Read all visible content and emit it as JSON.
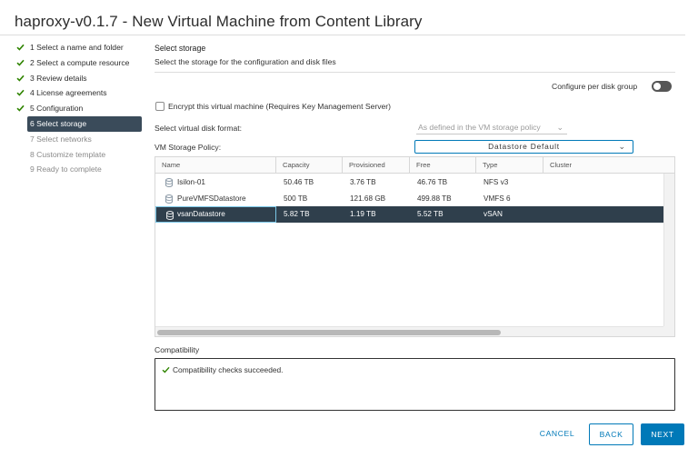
{
  "window": {
    "title": "haproxy-v0.1.7 - New Virtual Machine from Content Library"
  },
  "steps": [
    {
      "num": "1",
      "label": "1 Select a name and folder",
      "state": "done"
    },
    {
      "num": "2",
      "label": "2 Select a compute resource",
      "state": "done"
    },
    {
      "num": "3",
      "label": "3 Review details",
      "state": "done"
    },
    {
      "num": "4",
      "label": "4 License agreements",
      "state": "done"
    },
    {
      "num": "5",
      "label": "5 Configuration",
      "state": "done"
    },
    {
      "num": "6",
      "label": "6 Select storage",
      "state": "active"
    },
    {
      "num": "7",
      "label": "7 Select networks",
      "state": "pending"
    },
    {
      "num": "8",
      "label": "8 Customize template",
      "state": "pending"
    },
    {
      "num": "9",
      "label": "9 Ready to complete",
      "state": "pending"
    }
  ],
  "section": {
    "title": "Select storage",
    "subtitle": "Select the storage for the configuration and disk files"
  },
  "configure_per_disk": {
    "label": "Configure per disk group",
    "enabled": false
  },
  "encrypt": {
    "label": "Encrypt this virtual machine (Requires Key Management Server)",
    "checked": false
  },
  "disk_format": {
    "label": "Select virtual disk format:",
    "value": "As defined in the VM storage policy"
  },
  "storage_policy": {
    "label": "VM Storage Policy:",
    "value": "Datastore Default"
  },
  "grid": {
    "columns": [
      "Name",
      "Capacity",
      "Provisioned",
      "Free",
      "Type",
      "Cluster"
    ],
    "rows": [
      {
        "name": "Isilon-01",
        "capacity": "50.46 TB",
        "provisioned": "3.76 TB",
        "free": "46.76 TB",
        "type": "NFS v3",
        "cluster": "",
        "selected": false
      },
      {
        "name": "PureVMFSDatastore",
        "capacity": "500 TB",
        "provisioned": "121.68 GB",
        "free": "499.88 TB",
        "type": "VMFS 6",
        "cluster": "",
        "selected": false
      },
      {
        "name": "vsanDatastore",
        "capacity": "5.82 TB",
        "provisioned": "1.19 TB",
        "free": "5.52 TB",
        "type": "vSAN",
        "cluster": "",
        "selected": true
      }
    ]
  },
  "compatibility": {
    "label": "Compatibility",
    "message": "Compatibility checks succeeded."
  },
  "buttons": {
    "cancel": "CANCEL",
    "back": "BACK",
    "next": "NEXT"
  },
  "colors": {
    "accent": "#0079b8",
    "check": "#2f8400",
    "selected_row": "#2f3f4c",
    "active_step": "#3a4b5a"
  },
  "icons": {
    "step_done": "check-icon",
    "datastore": "datastore-icon",
    "select": "chevron-down-icon",
    "compat": "check-icon"
  }
}
